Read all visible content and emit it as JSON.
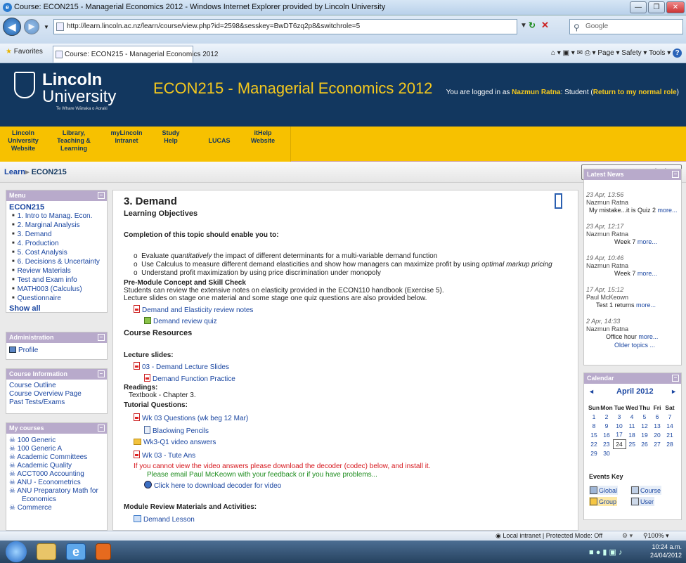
{
  "window": {
    "title": "Course: ECON215 - Managerial Economics 2012 - Windows Internet Explorer provided by Lincoln University"
  },
  "addressbar": {
    "url": "http://learn.lincoln.ac.nz/learn/course/view.php?id=2598&sesskey=BwDT6zq2p8&switchrole=5",
    "search_placeholder": "Google"
  },
  "favbar": {
    "favorites_label": "Favorites",
    "tab_title": "Course: ECON215 - Managerial Economics 2012",
    "page_menu": "Page",
    "safety_menu": "Safety",
    "tools_menu": "Tools"
  },
  "header": {
    "logo_line1": "Lincoln",
    "logo_line2": "University",
    "logo_motto": "Te Whare Wānaka o Aoraki",
    "course_title": "ECON215 - Managerial Economics 2012",
    "logged_in_prefix": "You are logged in as ",
    "user_name": "Nazmun Ratna",
    "role_text": ": Student (",
    "return_role_link": "Return to my normal role",
    "role_close": ")"
  },
  "nav": [
    {
      "label": "Lincoln University Website"
    },
    {
      "label": "Library, Teaching & Learning"
    },
    {
      "label": "myLincoln Intranet"
    },
    {
      "label": "Study Help"
    },
    {
      "label": "LUCAS"
    },
    {
      "label": "itHelp Website"
    }
  ],
  "breadcrumb": {
    "root": "Learn",
    "sep": "▸",
    "current": "ECON215",
    "return_button": "Return to my normal role"
  },
  "menu_block": {
    "title": "Menu",
    "course": "ECON215",
    "items": [
      "1. Intro to Manag. Econ.",
      "2. Marginal Analysis",
      "3. Demand",
      "4. Production",
      "5. Cost Analysis",
      "6. Decisions & Uncertainty",
      "Review Materials",
      "Test and Exam info",
      "MATH003 (Calculus)",
      "Questionnaire"
    ],
    "show_all": "Show all"
  },
  "admin_block": {
    "title": "Administration",
    "profile": "Profile"
  },
  "courseinfo_block": {
    "title": "Course Information",
    "links": [
      "Course Outline",
      "Course Overview Page",
      "Past Tests/Exams"
    ]
  },
  "mycourses_block": {
    "title": "My courses",
    "items": [
      "100 Generic",
      "100 Generic A",
      "Academic Committees",
      "Academic Quality",
      "ACCT000 Accounting",
      "ANU - Econometrics",
      "ANU Preparatory Math for",
      "Economics",
      "Commerce"
    ]
  },
  "main": {
    "section_title": "3. Demand",
    "learning_objectives": "Learning Objectives",
    "completion_heading": "Completion of this topic should enable you to:",
    "objectives": [
      {
        "pre": "Evaluate ",
        "em": "quantitatively",
        "post": " the impact of different determinants for  a multi-variable demand function"
      },
      {
        "pre": "Use Calculus to measure different demand elasticities and show how managers can maximize  profit by using ",
        "em": "optimal markup pricing",
        "post": ""
      },
      {
        "pre": "Understand profit maximization by using price discrimination under monopoly",
        "em": "",
        "post": ""
      }
    ],
    "premodule_heading": "Pre-Module Concept and Skill Check",
    "premodule_text1": "Students can review the extensive notes on elasticity provided in the ECON110 handbook (Exercise 5).",
    "premodule_text2": "Lecture slides on stage one material and some stage one quiz questions are also provided below.",
    "elasticity_notes": "Demand and Elasticity review notes",
    "review_quiz": "Demand review quiz",
    "course_resources": "Course Resources",
    "lecture_slides": "Lecture slides:",
    "lecture_slides_link": "03 - Demand Lecture Slides",
    "function_practice": "Demand Function Practice",
    "readings": "Readings:",
    "textbook": "Textbook - Chapter 3.",
    "tutorial_questions": "Tutorial Questions:",
    "wk03_questions": "Wk 03 Questions (wk beg 12 Mar)",
    "blackwing": "Blackwing Pencils",
    "video_answers": "Wk3-Q1 video answers",
    "tute_ans": "Wk 03 - Tute Ans",
    "red_notice": "If you cannot view the video answers please download the decoder (codec) below, and install it.",
    "green_notice": "Please email Paul McKeown with your feedback or if you have problems...",
    "download_decoder": "Click here to download decoder for video",
    "module_review": "Module Review Materials and Activities:",
    "demand_lesson": "Demand Lesson"
  },
  "news_block": {
    "title": "Latest News",
    "items": [
      {
        "date": "23 Apr, 13:56",
        "author": "Nazmun Ratna",
        "text": "My mistake...it is Quiz 2",
        "more": "more..."
      },
      {
        "date": "23 Apr, 12:17",
        "author": "Nazmun Ratna",
        "text": "Week 7",
        "more": "more..."
      },
      {
        "date": "19 Apr, 10:46",
        "author": "Nazmun Ratna",
        "text": "Week 7",
        "more": "more..."
      },
      {
        "date": "17 Apr, 15:12",
        "author": "Paul McKeown",
        "text": "Test 1 returns",
        "more": "more..."
      },
      {
        "date": "2 Apr, 14:33",
        "author": "Nazmun Ratna",
        "text": "Office hour",
        "more": "more..."
      }
    ],
    "older": "Older topics ..."
  },
  "calendar_block": {
    "title": "Calendar",
    "month": "April 2012",
    "prev": "◄",
    "next": "►",
    "weekdays": [
      "Sun",
      "Mon",
      "Tue",
      "Wed",
      "Thu",
      "Fri",
      "Sat"
    ],
    "weeks": [
      [
        "1",
        "2",
        "3",
        "4",
        "5",
        "6",
        "7"
      ],
      [
        "8",
        "9",
        "10",
        "11",
        "12",
        "13",
        "14"
      ],
      [
        "15",
        "16",
        "17",
        "18",
        "19",
        "20",
        "21"
      ],
      [
        "22",
        "23",
        "24",
        "25",
        "26",
        "27",
        "28"
      ],
      [
        "29",
        "30",
        "",
        "",
        "",
        "",
        ""
      ]
    ],
    "today": "24",
    "events_key": "Events Key",
    "keys": [
      "Global",
      "Course",
      "Group",
      "User"
    ]
  },
  "statusbar": {
    "zone": "Local intranet | Protected Mode: Off",
    "zoom": "100%"
  },
  "taskbar": {
    "time": "10:24 a.m.",
    "date": "24/04/2012"
  },
  "colors": {
    "header_bg": "#12375f",
    "nav_bg": "#f7c100",
    "block_head": "#b8aacb",
    "link": "#1a46a1"
  }
}
